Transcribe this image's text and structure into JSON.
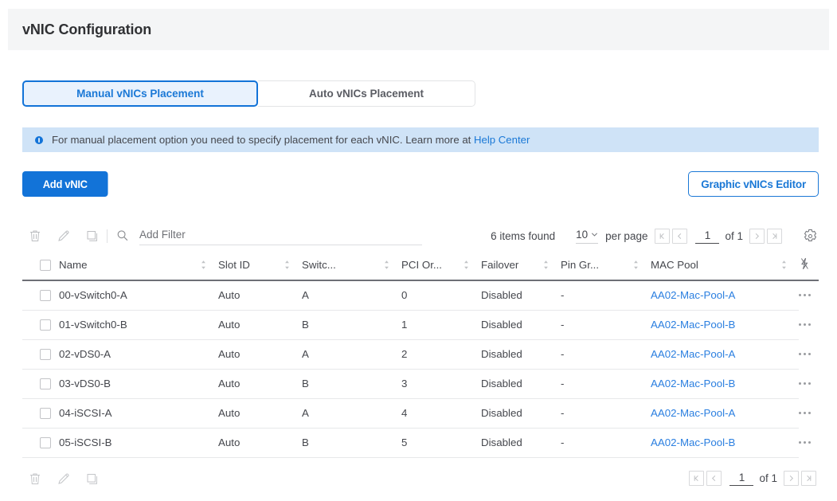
{
  "header": {
    "title": "vNIC Configuration"
  },
  "tabs": [
    {
      "label": "Manual vNICs Placement",
      "active": true
    },
    {
      "label": "Auto vNICs Placement",
      "active": false
    }
  ],
  "banner": {
    "text": "For manual placement option you need to specify placement for each vNIC. Learn more at",
    "link_label": "Help Center",
    "icon": "info-icon",
    "background": "#cfe3f7"
  },
  "actions": {
    "add_label": "Add vNIC",
    "graphic_editor_label": "Graphic vNICs Editor",
    "primary_color": "#1273d8",
    "link_color": "#1a78d6"
  },
  "toolbar": {
    "icons": [
      "delete-icon",
      "edit-icon",
      "clone-icon"
    ],
    "search_icon": "search-icon",
    "filter_placeholder": "Add Filter",
    "filter_value": "",
    "items_found": "6 items found",
    "per_page_value": "10",
    "per_page_label": "per page",
    "page_value": "1",
    "page_of": "of 1",
    "settings_icon": "gear-icon"
  },
  "table": {
    "columns": [
      {
        "label": "Name",
        "sortable": true
      },
      {
        "label": "Slot ID",
        "sortable": true
      },
      {
        "label": "Switc...",
        "sortable": true
      },
      {
        "label": "PCI Or...",
        "sortable": true
      },
      {
        "label": "Failover",
        "sortable": true
      },
      {
        "label": "Pin Gr...",
        "sortable": true
      },
      {
        "label": "MAC Pool",
        "sortable": true
      }
    ],
    "last_column_icon": "lightning-bolt-icon",
    "rows": [
      {
        "name": "00-vSwitch0-A",
        "slot_id": "Auto",
        "switch": "A",
        "pci_order": "0",
        "failover": "Disabled",
        "pin_group": "-",
        "mac_pool": "AA02-Mac-Pool-A"
      },
      {
        "name": "01-vSwitch0-B",
        "slot_id": "Auto",
        "switch": "B",
        "pci_order": "1",
        "failover": "Disabled",
        "pin_group": "-",
        "mac_pool": "AA02-Mac-Pool-B"
      },
      {
        "name": "02-vDS0-A",
        "slot_id": "Auto",
        "switch": "A",
        "pci_order": "2",
        "failover": "Disabled",
        "pin_group": "-",
        "mac_pool": "AA02-Mac-Pool-A"
      },
      {
        "name": "03-vDS0-B",
        "slot_id": "Auto",
        "switch": "B",
        "pci_order": "3",
        "failover": "Disabled",
        "pin_group": "-",
        "mac_pool": "AA02-Mac-Pool-B"
      },
      {
        "name": "04-iSCSI-A",
        "slot_id": "Auto",
        "switch": "A",
        "pci_order": "4",
        "failover": "Disabled",
        "pin_group": "-",
        "mac_pool": "AA02-Mac-Pool-A"
      },
      {
        "name": "05-iSCSI-B",
        "slot_id": "Auto",
        "switch": "B",
        "pci_order": "5",
        "failover": "Disabled",
        "pin_group": "-",
        "mac_pool": "AA02-Mac-Pool-B"
      }
    ]
  },
  "footer": {
    "icons": [
      "delete-icon",
      "edit-icon",
      "clone-icon"
    ],
    "page_value": "1",
    "page_of": "of 1"
  }
}
